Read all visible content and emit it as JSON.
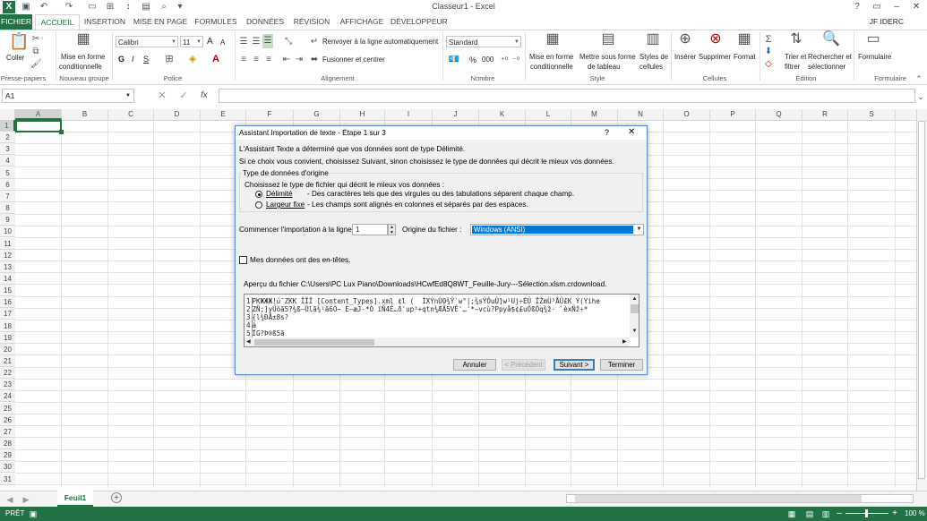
{
  "window": {
    "title": "Classeur1 - Excel",
    "user": "JF IDERC"
  },
  "tabs": [
    "FICHIER",
    "ACCUEIL",
    "INSERTION",
    "MISE EN PAGE",
    "FORMULES",
    "DONNÉES",
    "RÉVISION",
    "AFFICHAGE",
    "DÉVELOPPEUR"
  ],
  "ribbon": {
    "clipboard": {
      "paste": "Coller",
      "group": "Presse-papiers"
    },
    "new_group": {
      "format_label1": "Mise en forme",
      "format_label2": "conditionnelle",
      "group": "Nouveau groupe"
    },
    "font": {
      "name": "Calibri",
      "size": "11",
      "bold": "G",
      "italic": "I",
      "underline": "S",
      "grow": "A",
      "shrink": "A",
      "group": "Police"
    },
    "alignment": {
      "wrap": "Renvoyer à la ligne automatiquement",
      "merge": "Fusionner et centrer",
      "group": "Alignement"
    },
    "number": {
      "format": "Standard",
      "percent": "%",
      "thousands": "000",
      "group": "Nombre"
    },
    "style": {
      "cond1": "Mise en forme",
      "cond2": "conditionnelle",
      "table1": "Mettre sous forme",
      "table2": "de tableau",
      "cell1": "Styles de",
      "cell2": "cellules",
      "group": "Style"
    },
    "cells": {
      "insert": "Insérer",
      "delete": "Supprimer",
      "format": "Format",
      "group": "Cellules"
    },
    "edit": {
      "sort1": "Trier et",
      "sort2": "filtrer",
      "find1": "Rechercher et",
      "find2": "sélectionner",
      "group": "Édition"
    },
    "form": {
      "label": "Formulaire",
      "group": "Formulaire"
    }
  },
  "formula_bar": {
    "name_box": "A1",
    "fx": "fx",
    "value": ""
  },
  "grid": {
    "columns": [
      "A",
      "B",
      "C",
      "D",
      "E",
      "F",
      "G",
      "H",
      "I",
      "J",
      "K",
      "L",
      "M",
      "N",
      "O",
      "P",
      "Q",
      "R",
      "S"
    ],
    "rows": [
      "1",
      "2",
      "3",
      "4",
      "5",
      "6",
      "7",
      "8",
      "9",
      "10",
      "11",
      "12",
      "13",
      "14",
      "15",
      "16",
      "17",
      "18",
      "19",
      "20",
      "21",
      "22",
      "23",
      "24",
      "25",
      "26",
      "27",
      "28",
      "29",
      "30",
      "31"
    ]
  },
  "sheets": {
    "active": "Feuil1",
    "add": "+"
  },
  "status": {
    "left": "PRÊT",
    "zoom": "100 %"
  },
  "dialog": {
    "title": "Assistant Importation de texte - Étape 1 sur 3",
    "help": "?",
    "close": "✕",
    "line1": "L'Assistant Texte a déterminé que vos données sont de type Délimité.",
    "line2": "Si ce choix vous convient, choisissez Suivant, sinon choisissez le type de données qui décrit le mieux vos données.",
    "group_title": "Type de données d'origine",
    "group_sub": "Choisissez le type de fichier qui décrit le mieux vos données :",
    "opt1_label": "Délimité",
    "opt1_desc": "- Des caractères tels que des virgules ou des tabulations séparent chaque champ.",
    "opt2_label": "Largeur fixe",
    "opt2_desc": "- Les champs sont alignés en colonnes et séparés par des espaces.",
    "start_label": "Commencer l'importation à la ligne :",
    "start_value": "1",
    "origin_label": "Origine du fichier :",
    "origin_value": "Windows (ANSI)",
    "headers_label": "Mes données ont des en-têtes.",
    "preview_label": "Aperçu du fichier C:\\Users\\PC Lux Piano\\Downloads\\HCwfEd8Q8WT_Feuille-Jury---Sélection.xlsm.crdownload.",
    "preview_lines": [
      {
        "n": "1",
        "t": "PKЖЖЖ!ú¯ZKK ÏÏÏ [Content_Types].xml ¢l (  ÌXÝnÚ0¾Ÿ`w°|;¾sÝÔuÛ]w¹Uj÷ÈÛ ÏŽmÜ³ÅÜ£K Ý(Yihe"
      },
      {
        "n": "2",
        "t": "ZÑ;]yÛõã5?¾ß—Ûlã¾¹ã6Ò~ È—æJ-*Ò íÑ4É…ð'up³+qtn¾ÆÃ5VÊ'…'*—vcù?Ppyå$¢£uÔßÔq¾ž· `èxÑž÷*"
      },
      {
        "n": "3",
        "t": "{l¾ÐÅ±8s?"
      },
      {
        "n": "4",
        "t": "à"
      },
      {
        "n": "5",
        "t": "ÏG?Þ®ß5ã"
      }
    ],
    "btn_cancel": "Annuler",
    "btn_prev": "< Précédent",
    "btn_next": "Suivant >",
    "btn_finish": "Terminer"
  },
  "colors": {
    "excel_green": "#217346",
    "selection": "#0078d7"
  }
}
